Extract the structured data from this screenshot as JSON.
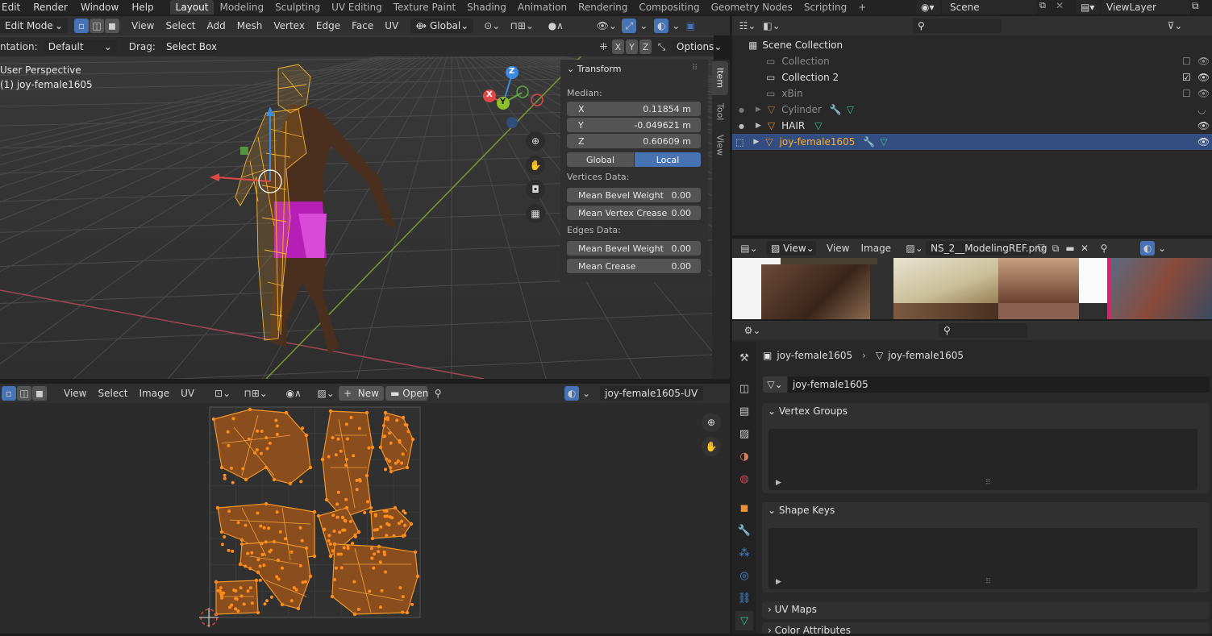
{
  "menu": [
    "Edit",
    "Render",
    "Window",
    "Help"
  ],
  "workspaces": [
    "Layout",
    "Modeling",
    "Sculpting",
    "UV Editing",
    "Texture Paint",
    "Shading",
    "Animation",
    "Rendering",
    "Compositing",
    "Geometry Nodes",
    "Scripting"
  ],
  "active_workspace": "Layout",
  "add_workspace": "+",
  "scene": "Scene",
  "view_layer": "ViewLayer",
  "viewport": {
    "mode": "Edit Mode",
    "menus": [
      "View",
      "Select",
      "Add",
      "Mesh",
      "Vertex",
      "Edge",
      "Face",
      "UV"
    ],
    "orientation_value": "Global",
    "orientation_label": "ntation:",
    "orientation_default": "Default",
    "drag_label": "Drag:",
    "drag_value": "Select Box",
    "options": "Options",
    "axes": [
      "X",
      "Y",
      "Z"
    ],
    "perspective": "User Perspective",
    "object": "(1) joy-female1605",
    "gizmo": {
      "x": "X",
      "y": "Y",
      "z": "Z"
    },
    "side_tabs": [
      "Item",
      "Tool",
      "View"
    ]
  },
  "transform": {
    "title": "Transform",
    "median": "Median:",
    "fields": [
      {
        "k": "X",
        "v": "0.11854 m"
      },
      {
        "k": "Y",
        "v": "-0.049621 m"
      },
      {
        "k": "Z",
        "v": "0.60609 m"
      }
    ],
    "global": "Global",
    "local": "Local",
    "vertices_data": "Vertices Data:",
    "mean_bevel_weight": "Mean Bevel Weight",
    "mean_bevel_weight_v": "0.00",
    "mean_vertex_crease": "Mean Vertex Crease",
    "mean_vertex_crease_v": "0.00",
    "edges_data": "Edges Data:",
    "edge_bevel_weight": "Mean Bevel Weight",
    "edge_bevel_weight_v": "0.00",
    "mean_crease": "Mean Crease",
    "mean_crease_v": "0.00"
  },
  "uv_editor": {
    "menus": [
      "View",
      "Select",
      "Image",
      "UV"
    ],
    "new": "New",
    "open": "Open",
    "uvmap": "joy-female1605-UV"
  },
  "outliner": {
    "root": "Scene Collection",
    "items": [
      {
        "name": "Collection",
        "muted": true
      },
      {
        "name": "Collection 2",
        "muted": false
      },
      {
        "name": "xBin",
        "muted": true
      },
      {
        "name": "Cylinder",
        "muted": true
      },
      {
        "name": "HAIR",
        "muted": false
      },
      {
        "name": "joy-female1605",
        "selected": true
      }
    ]
  },
  "image_editor": {
    "menus": [
      "View",
      "View",
      "Image"
    ],
    "image": "NS_2__ModelingREF.png"
  },
  "properties": {
    "breadcrumb_object": "joy-female1605",
    "breadcrumb_mesh": "joy-female1605",
    "mesh_name": "joy-female1605",
    "sections": [
      "Vertex Groups",
      "Shape Keys",
      "UV Maps",
      "Color Attributes"
    ]
  },
  "colors": {
    "accent": "#4772b3",
    "selection": "#334d80",
    "mesh_orange": "#e89a20",
    "uv_fill": "#8a4e1e"
  }
}
